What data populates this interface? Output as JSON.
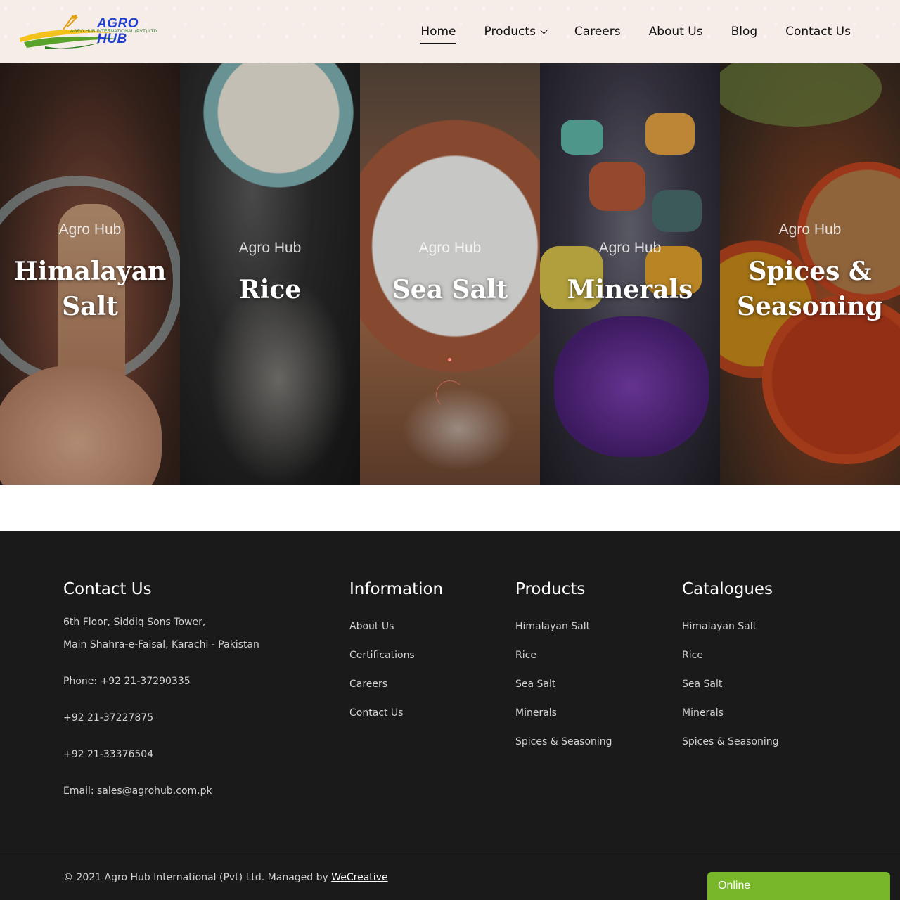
{
  "header": {
    "logo_title": "AGRO HUB",
    "logo_subtitle": "AGRO HUB INTERNATIONAL (PVT) LTD",
    "nav": [
      {
        "label": "Home",
        "active": true
      },
      {
        "label": "Products",
        "dropdown": true
      },
      {
        "label": "Careers"
      },
      {
        "label": "About Us"
      },
      {
        "label": "Blog"
      },
      {
        "label": "Contact Us"
      }
    ]
  },
  "hero": {
    "panels": [
      {
        "brand": "Agro Hub",
        "title_lines": [
          "Himalayan",
          "Salt"
        ]
      },
      {
        "brand": "Agro Hub",
        "title_lines": [
          "Rice"
        ]
      },
      {
        "brand": "Agro Hub",
        "title_lines": [
          "Sea Salt"
        ]
      },
      {
        "brand": "Agro Hub",
        "title_lines": [
          "Minerals"
        ]
      },
      {
        "brand": "Agro Hub",
        "title_lines": [
          "Spices &",
          "Seasoning"
        ]
      }
    ]
  },
  "footer": {
    "contact": {
      "heading": "Contact Us",
      "address_1": "6th Floor, Siddiq Sons Tower,",
      "address_2": "Main Shahra-e-Faisal, Karachi - Pakistan",
      "phone_1": "Phone: +92 21-37290335",
      "phone_2": "+92 21-37227875",
      "phone_3": "+92 21-33376504",
      "email": "Email: sales@agrohub.com.pk"
    },
    "information": {
      "heading": "Information",
      "links": [
        "About Us",
        "Certifications",
        "Careers",
        "Contact Us"
      ]
    },
    "products": {
      "heading": "Products",
      "links": [
        "Himalayan Salt",
        "Rice",
        "Sea Salt",
        "Minerals",
        "Spices & Seasoning"
      ]
    },
    "catalogues": {
      "heading": "Catalogues",
      "links": [
        "Himalayan Salt",
        "Rice",
        "Sea Salt",
        "Minerals",
        "Spices & Seasoning"
      ]
    },
    "copyright_text": "© 2021 Agro Hub International (Pvt) Ltd. Managed by ",
    "managed_by": "WeCreative"
  },
  "chat_widget": {
    "label": "Online",
    "color": "#78b72a"
  }
}
